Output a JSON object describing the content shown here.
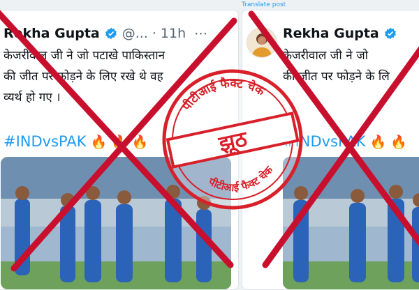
{
  "translate_link": "Translate post",
  "left_post": {
    "author_name": "Rekha Gupta",
    "handle": "@...",
    "separator": "·",
    "time": "11h",
    "menu": "⋯",
    "text_lines": [
      "केजरीवाल जी ने जो पटाखे पाकिस्तान",
      "की जीत पर फोड़ने के लिए रखे थे वह",
      "व्यर्थ हो गए ।"
    ],
    "hashtag": "#INDvsPAK"
  },
  "right_post": {
    "author_name": "Rekha Gupta",
    "text_lines": [
      "केजरीवाल जी ने जो",
      "की जीत पर फोड़ने के लि",
      ""
    ],
    "hashtag": "#INDvsPAK"
  },
  "stamp": {
    "top_text": "पीटीआई फैक्ट चेक",
    "center_word": "झूठ",
    "bottom_text": "पीटीआई फैक्ट चेक"
  },
  "colors": {
    "verified_badge": "#1d9bf0",
    "hashtag": "#1d9bf0",
    "stamp_red": "#d8202a",
    "cross_red": "#c8102e"
  },
  "icons": {
    "verified": "verified-badge-icon",
    "fire": "fire-emoji-icon"
  }
}
